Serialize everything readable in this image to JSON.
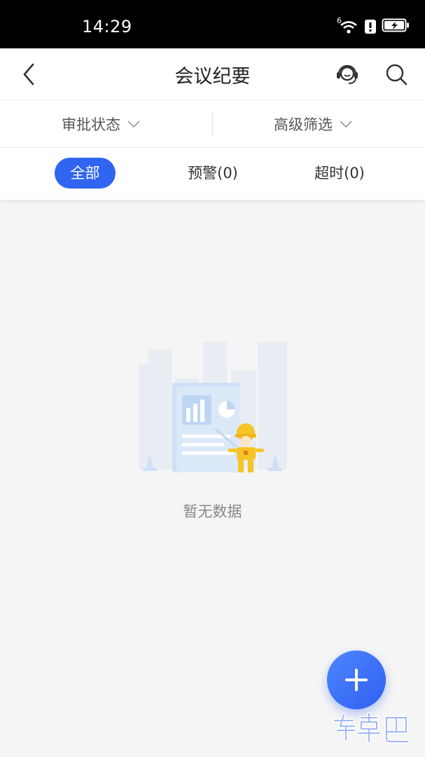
{
  "status_bar": {
    "time": "14:29",
    "network_badge": "6"
  },
  "nav": {
    "title": "会议纪要"
  },
  "filters": {
    "approval_label": "审批状态",
    "advanced_label": "高级筛选"
  },
  "tabs": [
    {
      "label": "全部",
      "active": true
    },
    {
      "label": "预警(0)",
      "active": false
    },
    {
      "label": "超时(0)",
      "active": false
    }
  ],
  "empty_state": {
    "message": "暂无数据"
  },
  "watermark": {
    "text": "安卓巴"
  },
  "colors": {
    "accent": "#2f65f0",
    "illustration_yellow": "#f7c427"
  },
  "icons": {
    "back": "chevron-left-icon",
    "service": "headset-icon",
    "search": "search-icon",
    "dropdown": "chevron-down-icon",
    "fab": "plus-icon"
  }
}
